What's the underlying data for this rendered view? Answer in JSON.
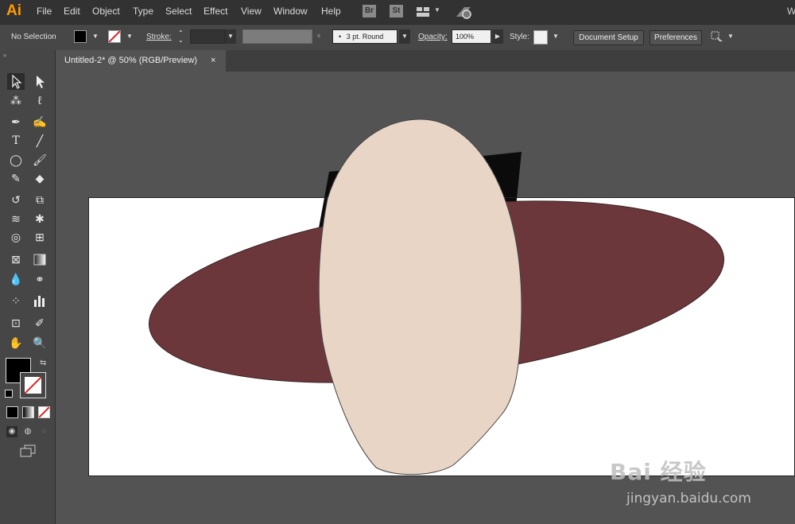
{
  "app": {
    "logo": "Ai"
  },
  "menu": [
    "File",
    "Edit",
    "Object",
    "Type",
    "Select",
    "Effect",
    "View",
    "Window",
    "Help"
  ],
  "bridge": {
    "br": "Br",
    "st": "St"
  },
  "control": {
    "selection": "No Selection",
    "stroke_label": "Stroke:",
    "brush": "3 pt. Round",
    "opacity_label": "Opacity:",
    "opacity": "100%",
    "style_label": "Style:",
    "doc_setup": "Document Setup",
    "preferences": "Preferences"
  },
  "tab": {
    "title": "Untitled-2* @ 50% (RGB/Preview)",
    "close": "×"
  },
  "colors": {
    "ellipse_dark": "#6b373b",
    "ellipse_light": "#e8d5c6",
    "black_shape": "#0b0b0b"
  },
  "watermark": {
    "brand": "Bai 经验",
    "url": "jingyan.baidu.com"
  }
}
